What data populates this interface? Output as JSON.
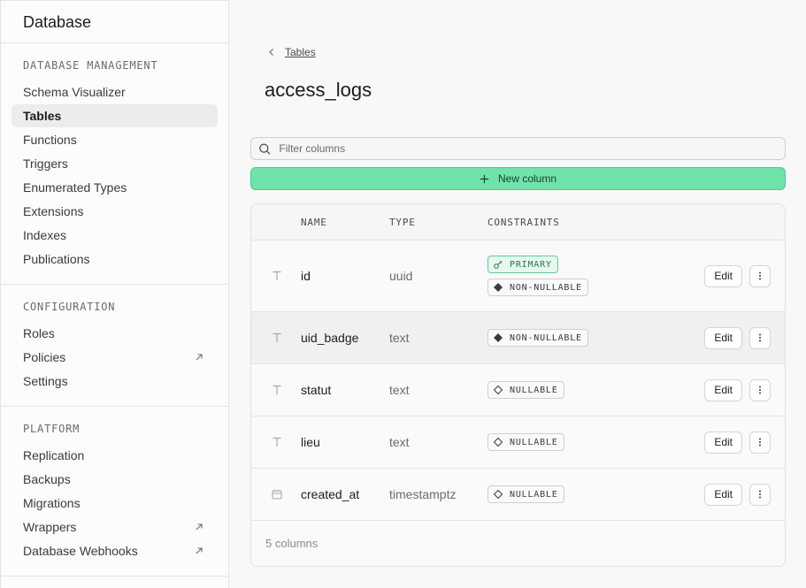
{
  "sidebar": {
    "title": "Database",
    "sections": [
      {
        "title": "DATABASE MANAGEMENT",
        "items": [
          {
            "label": "Schema Visualizer",
            "active": false,
            "external": false
          },
          {
            "label": "Tables",
            "active": true,
            "external": false
          },
          {
            "label": "Functions",
            "active": false,
            "external": false
          },
          {
            "label": "Triggers",
            "active": false,
            "external": false
          },
          {
            "label": "Enumerated Types",
            "active": false,
            "external": false
          },
          {
            "label": "Extensions",
            "active": false,
            "external": false
          },
          {
            "label": "Indexes",
            "active": false,
            "external": false
          },
          {
            "label": "Publications",
            "active": false,
            "external": false
          }
        ]
      },
      {
        "title": "CONFIGURATION",
        "items": [
          {
            "label": "Roles",
            "active": false,
            "external": false
          },
          {
            "label": "Policies",
            "active": false,
            "external": true
          },
          {
            "label": "Settings",
            "active": false,
            "external": false
          }
        ]
      },
      {
        "title": "PLATFORM",
        "items": [
          {
            "label": "Replication",
            "active": false,
            "external": false
          },
          {
            "label": "Backups",
            "active": false,
            "external": false
          },
          {
            "label": "Migrations",
            "active": false,
            "external": false
          },
          {
            "label": "Wrappers",
            "active": false,
            "external": true
          },
          {
            "label": "Database Webhooks",
            "active": false,
            "external": true
          }
        ]
      }
    ]
  },
  "main": {
    "breadcrumb": "Tables",
    "title": "access_logs",
    "filter_placeholder": "Filter columns",
    "new_column_label": "New column",
    "table": {
      "headers": {
        "name": "NAME",
        "type": "TYPE",
        "constraints": "CONSTRAINTS"
      },
      "rows": [
        {
          "name": "id",
          "type": "uuid",
          "icon": "text-icon",
          "highlight": false,
          "constraints": [
            {
              "label": "PRIMARY",
              "kind": "primary"
            },
            {
              "label": "NON-NULLABLE",
              "kind": "non-nullable"
            }
          ]
        },
        {
          "name": "uid_badge",
          "type": "text",
          "icon": "text-icon",
          "highlight": true,
          "constraints": [
            {
              "label": "NON-NULLABLE",
              "kind": "non-nullable"
            }
          ]
        },
        {
          "name": "statut",
          "type": "text",
          "icon": "text-icon",
          "highlight": false,
          "constraints": [
            {
              "label": "NULLABLE",
              "kind": "nullable"
            }
          ]
        },
        {
          "name": "lieu",
          "type": "text",
          "icon": "text-icon",
          "highlight": false,
          "constraints": [
            {
              "label": "NULLABLE",
              "kind": "nullable"
            }
          ]
        },
        {
          "name": "created_at",
          "type": "timestamptz",
          "icon": "calendar-icon",
          "highlight": false,
          "constraints": [
            {
              "label": "NULLABLE",
              "kind": "nullable"
            }
          ]
        }
      ],
      "edit_label": "Edit",
      "footer": "5 columns"
    }
  },
  "colors": {
    "accent": "#6ee3aa",
    "primary_badge_bg": "#e7f8ee",
    "primary_badge_text": "#1e7a4d"
  }
}
